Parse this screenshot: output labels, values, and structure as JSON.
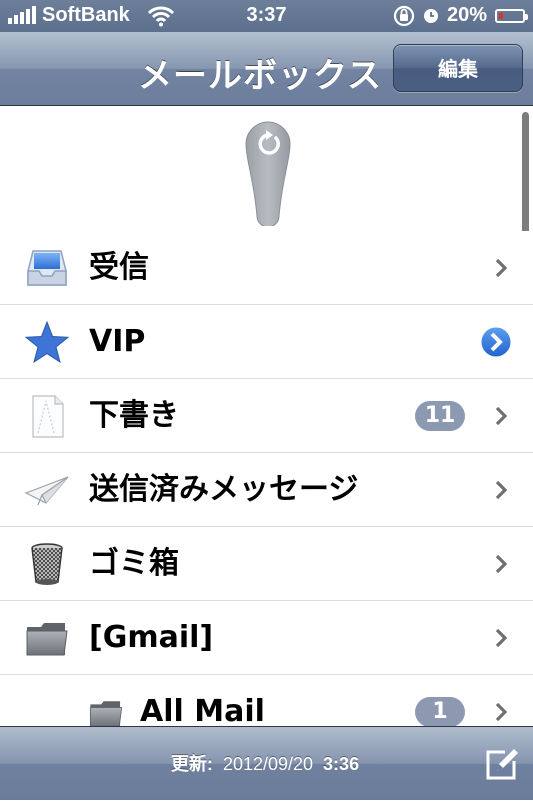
{
  "status_bar": {
    "carrier": "SoftBank",
    "time": "3:37",
    "battery": "20%",
    "battery_level": 0.2
  },
  "nav": {
    "title": "メールボックス",
    "edit_label": "編集"
  },
  "mailboxes": [
    {
      "label": "受信",
      "icon": "inbox-icon"
    },
    {
      "label": "VIP",
      "icon": "star-icon"
    },
    {
      "label": "下書き",
      "icon": "draft-icon",
      "badge": "11"
    },
    {
      "label": "送信済みメッセージ",
      "icon": "sent-icon"
    },
    {
      "label": "ゴミ箱",
      "icon": "trash-icon"
    },
    {
      "label": "[Gmail]",
      "icon": "folder-icon"
    },
    {
      "label": "All Mail",
      "icon": "folder-icon",
      "badge": "1"
    }
  ],
  "toolbar": {
    "updated_label": "更新:",
    "updated_date": "2012/09/20",
    "updated_time": "3:36"
  },
  "colors": {
    "bar_blue": "#6c7e9b",
    "badge": "#8c99b1",
    "vip_star": "#3d74d6"
  }
}
